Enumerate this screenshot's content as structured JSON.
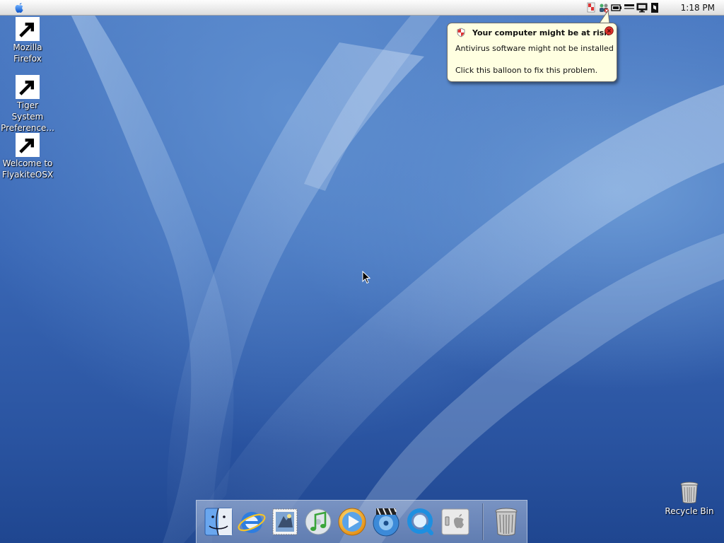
{
  "menubar": {
    "apple_icon": "apple-icon",
    "tray_icons": [
      "security-shield-icon",
      "network-users-icon",
      "battery-icon",
      "display-icon",
      "monitor-icon",
      "volume-icon"
    ],
    "clock": "1:18 PM"
  },
  "desktop_icons": [
    {
      "name": "firefox",
      "icon": "firefox-icon",
      "line1": "Mozilla",
      "line2": "Firefox"
    },
    {
      "name": "tiger-system-preferences",
      "icon": "system-preferences-icon",
      "line1": "Tiger System",
      "line2": "Preference..."
    },
    {
      "name": "welcome",
      "icon": "welcome-at-icon",
      "line1": "Welcome to",
      "line2": "FlyakiteOSX"
    }
  ],
  "balloon": {
    "title": "Your computer might be at risk",
    "line1": "Antivirus software might not be installed",
    "line2": "Click this balloon to fix this problem.",
    "icon": "shield-icon",
    "close_icon": "close-icon",
    "colors": {
      "background": "#ffffe1",
      "close": "#d9302a"
    }
  },
  "recycle_bin": {
    "label": "Recycle Bin",
    "icon": "trash-icon"
  },
  "dock": {
    "items": [
      {
        "name": "finder",
        "icon": "finder-icon",
        "running": true
      },
      {
        "name": "internet-explorer",
        "icon": "internet-explorer-icon",
        "running": false
      },
      {
        "name": "mail",
        "icon": "mail-stamp-icon",
        "running": false
      },
      {
        "name": "itunes",
        "icon": "itunes-icon",
        "running": false
      },
      {
        "name": "media-player",
        "icon": "media-player-icon",
        "running": false
      },
      {
        "name": "dvd-player",
        "icon": "dvd-player-icon",
        "running": false
      },
      {
        "name": "quicktime",
        "icon": "quicktime-icon",
        "running": false
      },
      {
        "name": "system-switch",
        "icon": "apple-switch-icon",
        "running": false
      },
      {
        "name": "trash",
        "icon": "trash-icon",
        "running": false
      }
    ]
  }
}
